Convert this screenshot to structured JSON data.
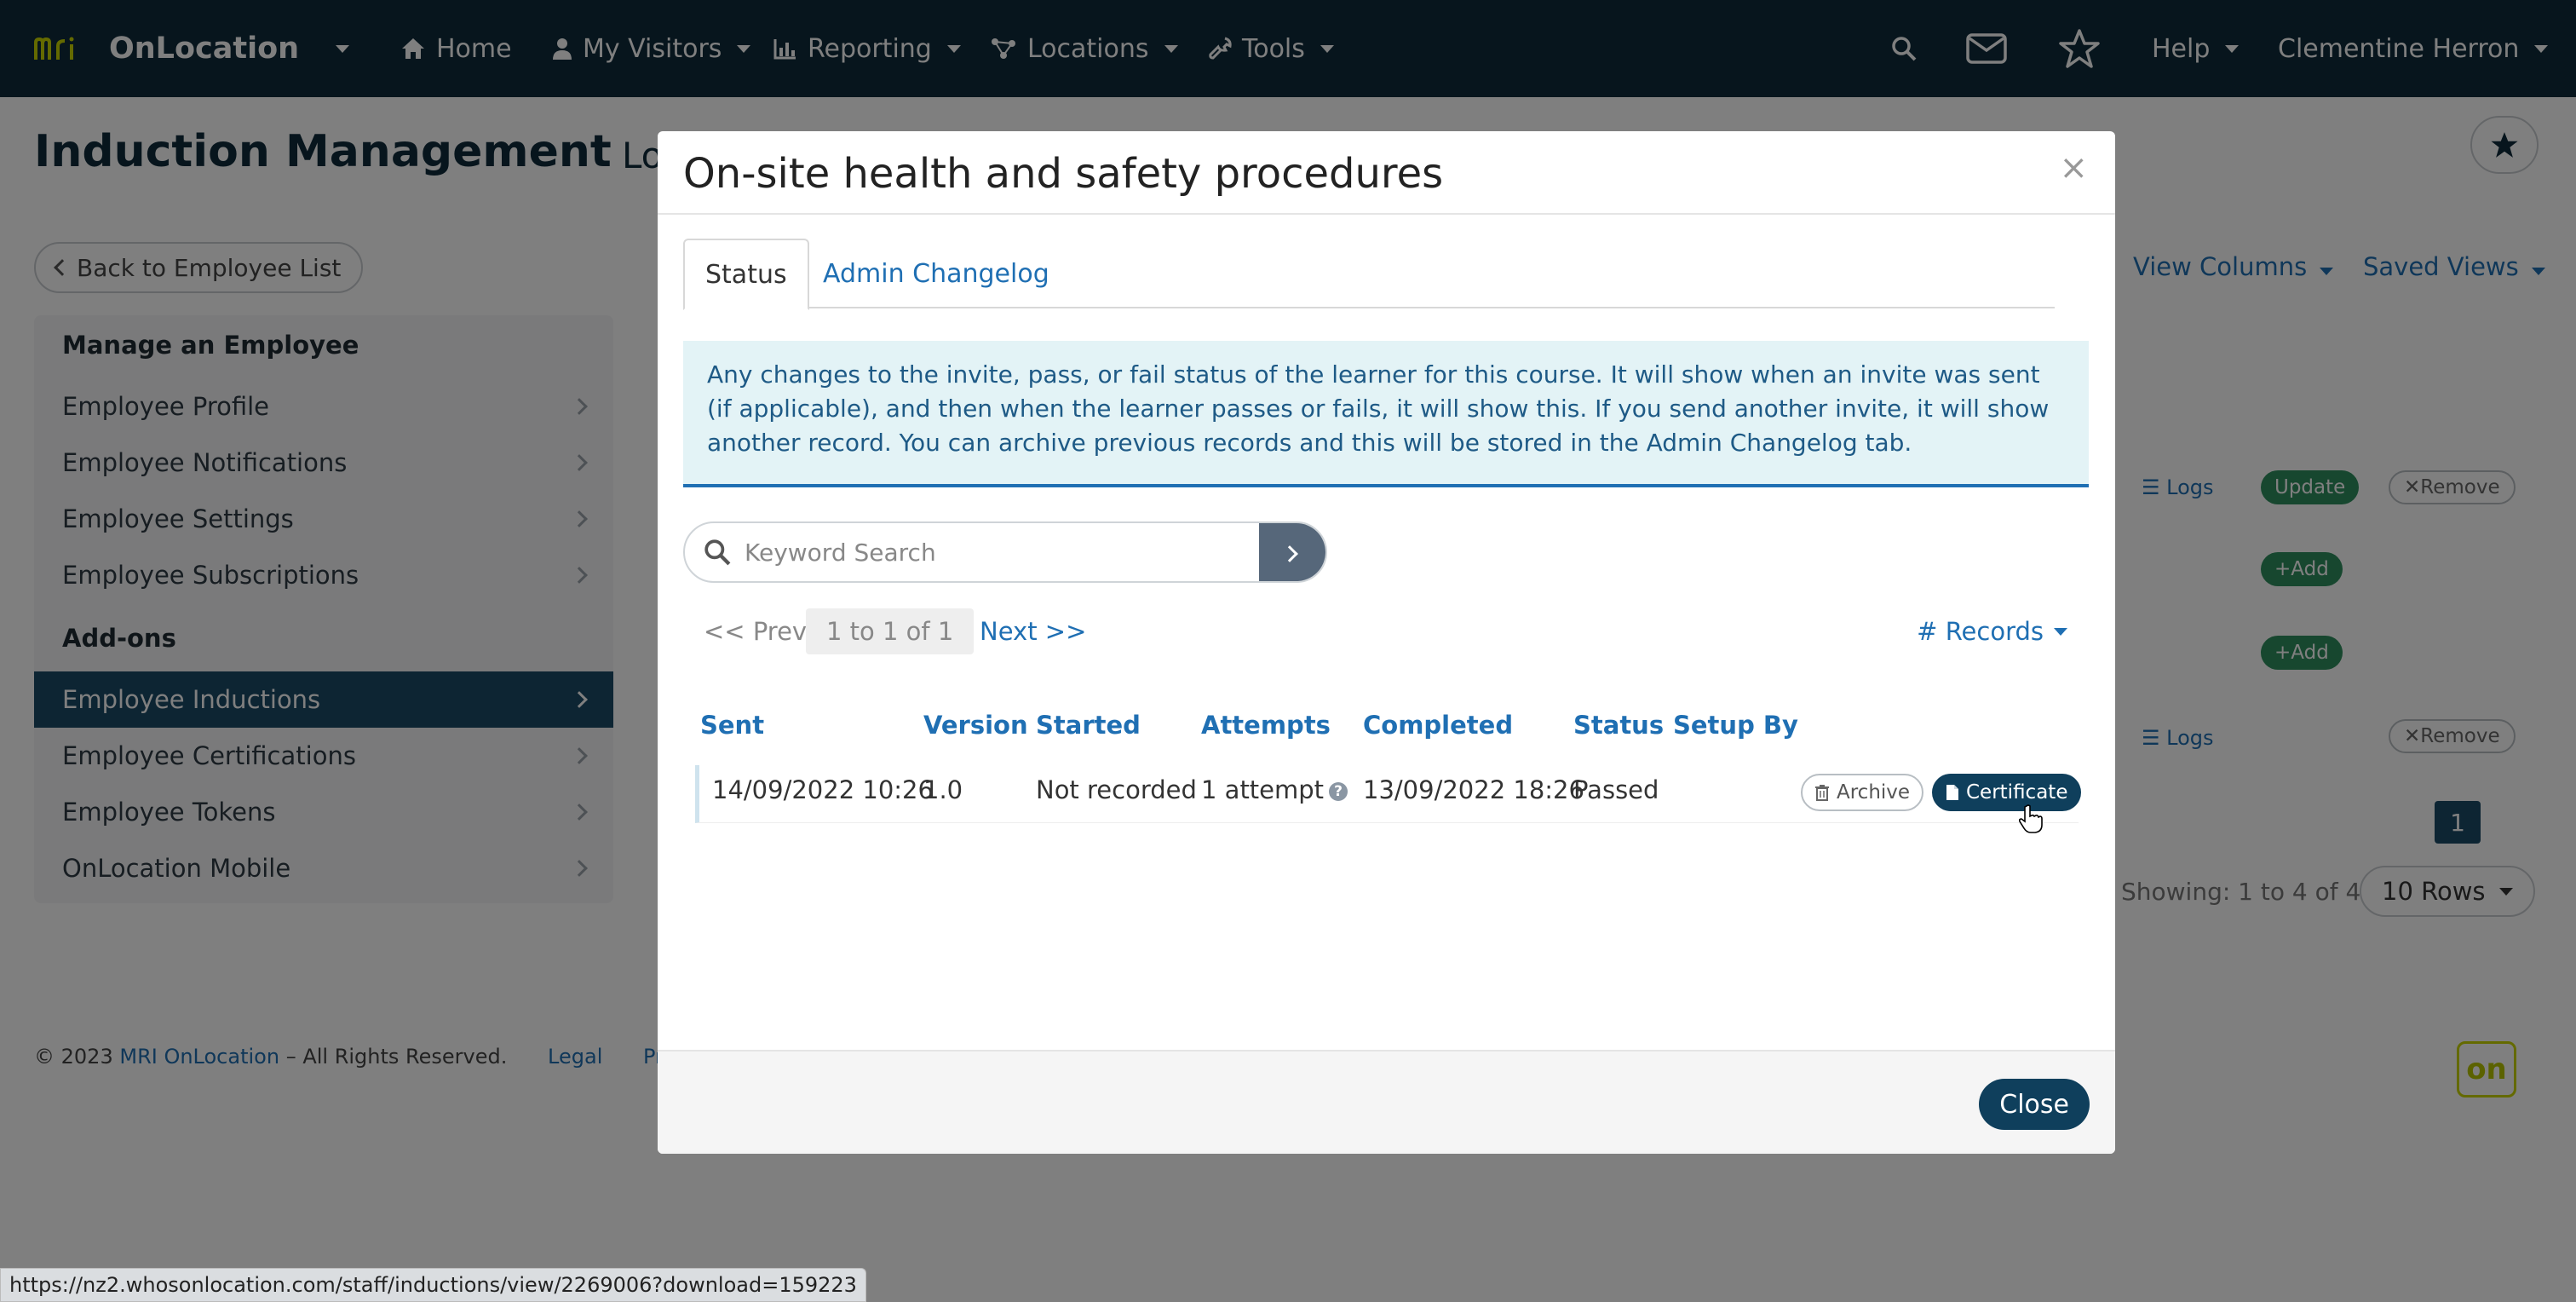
{
  "nav": {
    "brand": "OnLocation",
    "home": "Home",
    "my_visitors": "My Visitors",
    "reporting": "Reporting",
    "locations": "Locations",
    "tools": "Tools",
    "help": "Help",
    "user": "Clementine Herron"
  },
  "page": {
    "title": "Induction Management",
    "subtitle_fragment": "Lo",
    "back_label": "Back to Employee List"
  },
  "sidebar": {
    "section1": "Manage an Employee",
    "items1": [
      "Employee Profile",
      "Employee Notifications",
      "Employee Settings",
      "Employee Subscriptions"
    ],
    "section2": "Add-ons",
    "items2": [
      "Employee Inductions",
      "Employee Certifications",
      "Employee Tokens",
      "OnLocation Mobile"
    ],
    "active": "Employee Inductions"
  },
  "background_right": {
    "view_columns": "View Columns",
    "saved_views": "Saved Views",
    "logs": "Logs",
    "update": "Update",
    "remove": "Remove",
    "add": "Add",
    "page_number": "1",
    "showing": "Showing: 1 to 4 of 4",
    "rows": "10 Rows"
  },
  "footer": {
    "copyright": "© 2023",
    "company": "MRI OnLocation",
    "rights": "– All Rights Reserved.",
    "legal": "Legal",
    "privacy": "Privac",
    "badge": "on"
  },
  "modal": {
    "title": "On-site health and safety procedures",
    "close_x": "×",
    "tabs": [
      "Status",
      "Admin Changelog"
    ],
    "info": "Any changes to the invite, pass, or fail status of the learner for this course. It will show when an invite was sent (if applicable), and then when the learner passes or fails, it will show this. If you send another invite, it will show another record. You can archive previous records and this will be stored in the Admin Changelog tab.",
    "search_placeholder": "Keyword Search",
    "pager": {
      "prev": "<< Prev",
      "range": "1 to 1 of 1",
      "next": "Next >>"
    },
    "records_label": "# Records",
    "columns": [
      "Sent",
      "Version",
      "Started",
      "Attempts",
      "Completed",
      "Status",
      "Setup By"
    ],
    "rows": [
      {
        "sent": "14/09/2022 10:26",
        "version": "1.0",
        "started": "Not recorded",
        "attempts": "1 attempt",
        "completed": "13/09/2022 18:26",
        "status": "Passed",
        "setup_by": ""
      }
    ],
    "archive_label": "Archive",
    "certificate_label": "Certificate",
    "close_label": "Close"
  },
  "status_url": "https://nz2.whosonlocation.com/staff/inductions/view/2269006?download=159223",
  "colors": {
    "nav_bg": "#0f2b3a",
    "primary_dark": "#0f3f5c",
    "link": "#1f6fb3",
    "info_bg": "#e3f3f6",
    "active_side": "#1b4a66"
  }
}
